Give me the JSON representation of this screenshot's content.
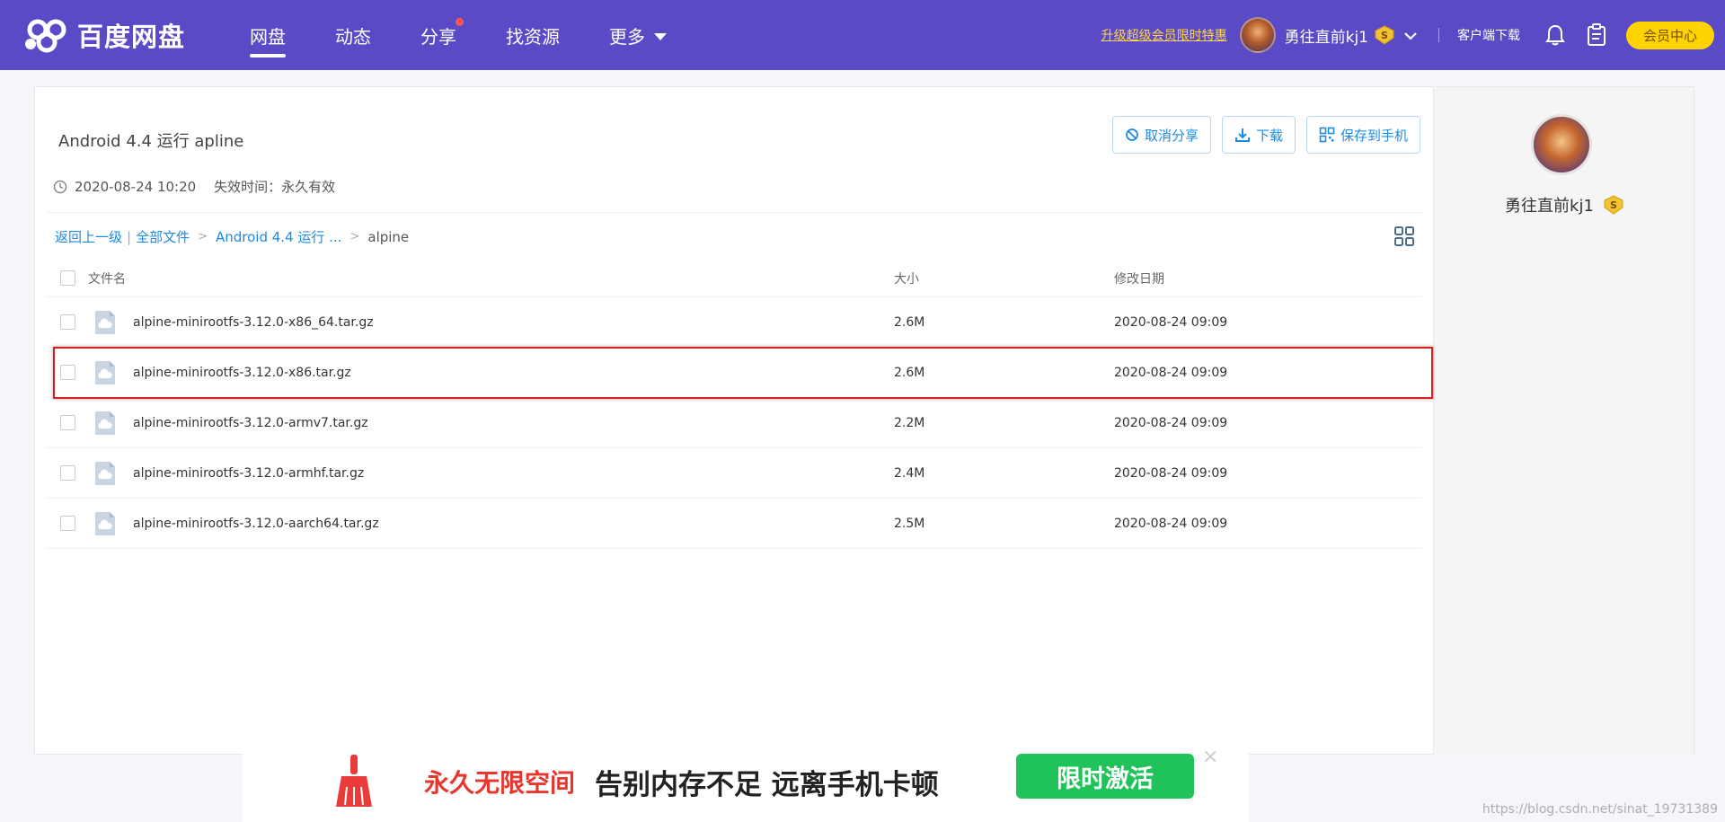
{
  "header": {
    "logo_text": "百度网盘",
    "nav": [
      {
        "label": "网盘",
        "active": true
      },
      {
        "label": "动态"
      },
      {
        "label": "分享",
        "dot": true
      },
      {
        "label": "找资源"
      },
      {
        "label": "更多",
        "caret": true
      }
    ],
    "promo": "升级超级会员限时特惠",
    "username": "勇往直前kj1",
    "client_download": "客户端下载",
    "vip_center": "会员中心"
  },
  "share": {
    "title": "Android 4.4 运行 apline",
    "created": "2020-08-24 10:20",
    "expire": "失效时间：永久有效",
    "buttons": {
      "cancel_share": "取消分享",
      "download": "下载",
      "save_to_phone": "保存到手机"
    }
  },
  "breadcrumb": {
    "back": "返回上一级",
    "all_files": "全部文件",
    "parent": "Android 4.4 运行 ...",
    "current": "alpine"
  },
  "columns": {
    "name": "文件名",
    "size": "大小",
    "date": "修改日期"
  },
  "files": [
    {
      "name": "alpine-minirootfs-3.12.0-x86_64.tar.gz",
      "size": "2.6M",
      "date": "2020-08-24 09:09"
    },
    {
      "name": "alpine-minirootfs-3.12.0-x86.tar.gz",
      "size": "2.6M",
      "date": "2020-08-24 09:09"
    },
    {
      "name": "alpine-minirootfs-3.12.0-armv7.tar.gz",
      "size": "2.2M",
      "date": "2020-08-24 09:09"
    },
    {
      "name": "alpine-minirootfs-3.12.0-armhf.tar.gz",
      "size": "2.4M",
      "date": "2020-08-24 09:09"
    },
    {
      "name": "alpine-minirootfs-3.12.0-aarch64.tar.gz",
      "size": "2.5M",
      "date": "2020-08-24 09:09"
    }
  ],
  "side": {
    "username": "勇往直前kj1"
  },
  "ad": {
    "red_text": "永久无限空间",
    "black_text": "告别内存不足 远离手机卡顿",
    "button": "限时激活",
    "close": "×"
  },
  "watermark": "https://blog.csdn.net/sinat_19731389",
  "colors": {
    "header_bg": "#5b4ac6",
    "link": "#1d8ae5",
    "vip_yellow": "#ffd400",
    "ad_green": "#20c25a",
    "highlight_red": "#d61f1f"
  }
}
